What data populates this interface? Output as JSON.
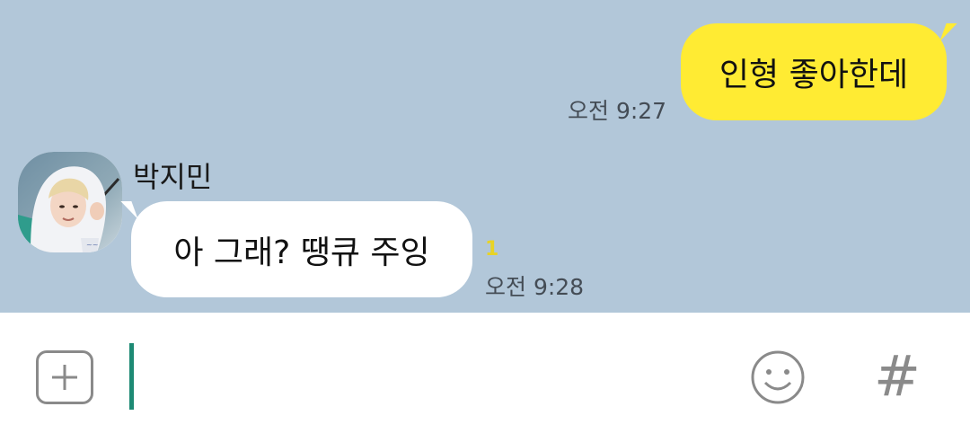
{
  "colors": {
    "chat_background": "#b2c7d9",
    "sent_bubble": "#ffeb33",
    "received_bubble": "#ffffff",
    "unread": "#e8d325",
    "caret": "#1d8a74",
    "icon_gray": "#8a8a8a"
  },
  "messages": [
    {
      "direction": "sent",
      "text": "인형 좋아한데",
      "time": "오전 9:27"
    },
    {
      "direction": "received",
      "sender": "박지민",
      "text": "아 그래? 땡큐 주잉",
      "unread_count": "1",
      "time": "오전 9:28"
    }
  ],
  "input_bar": {
    "plus_icon": "plus-square-icon",
    "input_value": "",
    "emoji_icon": "smiley-icon",
    "hash_label": "#"
  }
}
